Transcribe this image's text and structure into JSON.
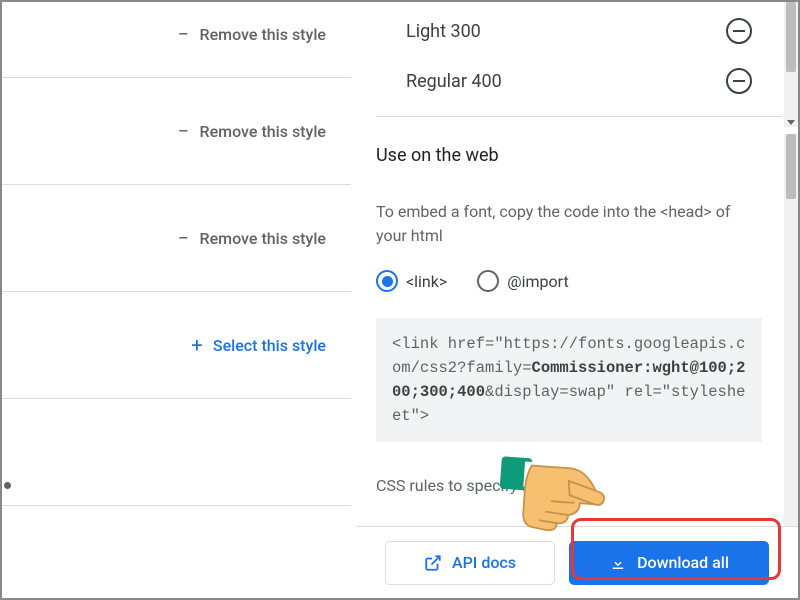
{
  "left": {
    "rows": [
      {
        "kind": "remove",
        "label": "Remove this style"
      },
      {
        "kind": "remove",
        "label": "Remove this style"
      },
      {
        "kind": "remove",
        "label": "Remove this style"
      },
      {
        "kind": "select",
        "label": "Select this style"
      }
    ]
  },
  "weights": [
    {
      "name": "Light 300"
    },
    {
      "name": "Regular 400"
    }
  ],
  "use": {
    "title": "Use on the web",
    "desc": "To embed a font, copy the code into the <head> of your html",
    "radios": {
      "link": "<link>",
      "import": "@import"
    },
    "code_prefix": "<link href=\"https://fonts.googleapis.com/css2?family=",
    "code_bold": "Commissioner:wght@100;200;300;400",
    "code_suffix": "&display=swap\" rel=\"stylesheet\">",
    "css_rules": "CSS rules to specify families"
  },
  "footer": {
    "api_docs": "API docs",
    "download_all": "Download all"
  }
}
